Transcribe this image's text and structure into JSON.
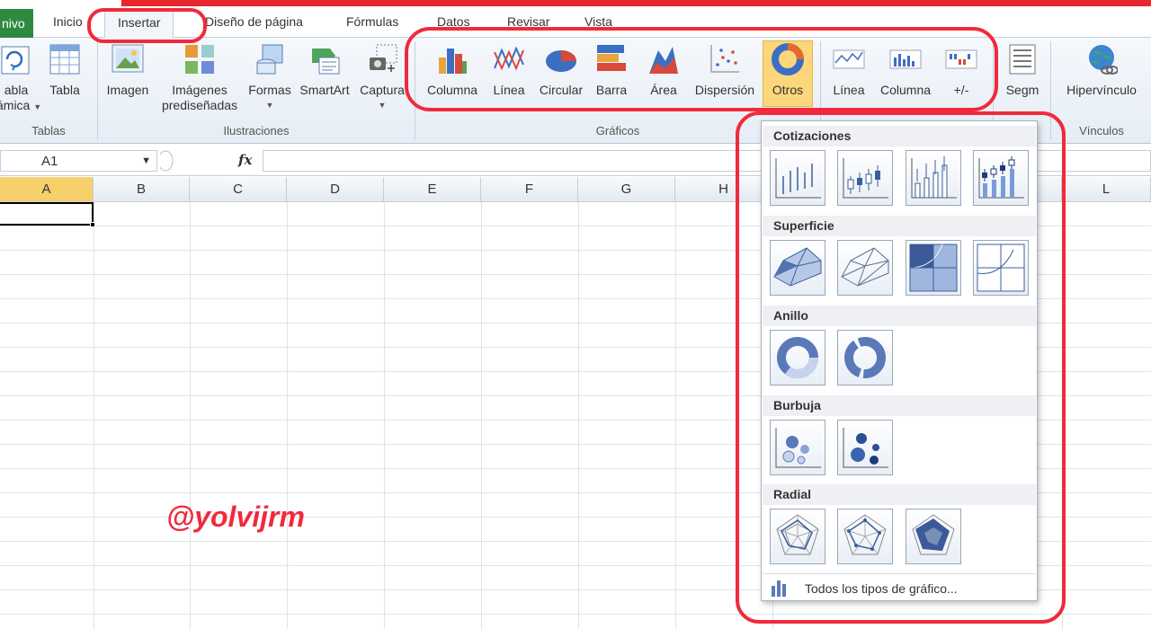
{
  "tabs": {
    "file": "nivo",
    "home": "Inicio",
    "insert": "Insertar",
    "layout": "Diseño de página",
    "formulas": "Fórmulas",
    "data": "Datos",
    "review": "Revisar",
    "view": "Vista"
  },
  "ribbon": {
    "tables": {
      "group": "Tablas",
      "pivot_line1": "abla",
      "pivot_line2": "ámica",
      "table": "Tabla"
    },
    "illustrations": {
      "group": "Ilustraciones",
      "image": "Imagen",
      "clipart_line1": "Imágenes",
      "clipart_line2": "prediseñadas",
      "shapes": "Formas",
      "smartart": "SmartArt",
      "screenshot": "Captura"
    },
    "charts": {
      "group": "Gráficos",
      "column": "Columna",
      "line": "Línea",
      "pie": "Circular",
      "bar": "Barra",
      "area": "Área",
      "scatter": "Dispersión",
      "other": "Otros"
    },
    "sparklines": {
      "line": "Línea",
      "column": "Columna",
      "winloss": "+/-"
    },
    "filter": {
      "slicer": "Segm"
    },
    "links": {
      "group": "Vínculos",
      "hyperlink": "Hipervínculo"
    }
  },
  "formula_bar": {
    "name_box": "A1",
    "fx": "fx",
    "formula": ""
  },
  "columns": [
    "A",
    "B",
    "C",
    "D",
    "E",
    "F",
    "G",
    "H",
    "L"
  ],
  "dropdown": {
    "sections": [
      "Cotizaciones",
      "Superficie",
      "Anillo",
      "Burbuja",
      "Radial"
    ],
    "all_types": "Todos los tipos de gráfico..."
  },
  "watermark": "@yolvijrm",
  "colors": {
    "accent_red": "#f02a3c",
    "file_tab": "#2f8a3f",
    "selected_header": "#f7cf6b"
  }
}
